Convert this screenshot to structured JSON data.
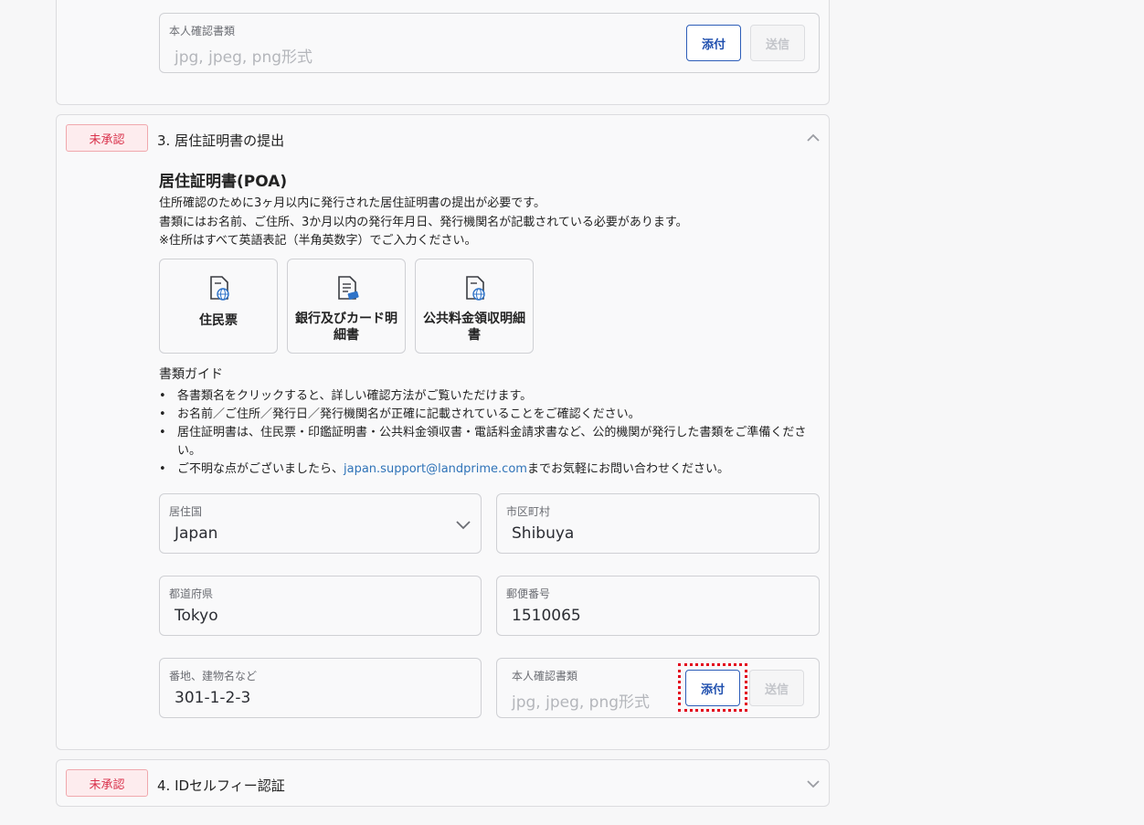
{
  "top_card": {
    "field_label": "本人確認書類",
    "field_placeholder": "jpg, jpeg, png形式",
    "attach_label": "添付",
    "send_label": "送信"
  },
  "step3": {
    "badge": "未承認",
    "title": "3. 居住証明書の提出",
    "heading": "居住証明書(POA)",
    "desc_lines": [
      "住所確認のために3ヶ月以内に発行された居住証明書の提出が必要です。",
      "書類にはお名前、ご住所、3か月以内の発行年月日、発行機関名が記載されている必要があります。",
      "※住所はすべて英語表記（半角英数字）でご入力ください。"
    ],
    "doc_types": [
      {
        "label": "住民票",
        "icon": "document-globe-icon"
      },
      {
        "label": "銀行及びカード明細書",
        "icon": "document-card-icon"
      },
      {
        "label": "公共料金領収明細書",
        "icon": "document-globe-icon"
      }
    ],
    "guide_title": "書類ガイド",
    "guide_items": [
      "各書類名をクリックすると、詳しい確認方法がご覧いただけます。",
      "お名前／ご住所／発行日／発行機関名が正確に記載されていることをご確認ください。",
      "居住証明書は、住民票・印鑑証明書・公共料金領収書・電話料金請求書など、公的機関が発行した書類をご準備ください。"
    ],
    "guide_contact_prefix": "ご不明な点がございましたら、",
    "guide_contact_email": "japan.support@landprime.com",
    "guide_contact_suffix": "までお気軽にお問い合わせください。",
    "fields": {
      "country_label": "居住国",
      "country_value": "Japan",
      "city_label": "市区町村",
      "city_value": "Shibuya",
      "prefecture_label": "都道府県",
      "prefecture_value": "Tokyo",
      "postal_label": "郵便番号",
      "postal_value": "1510065",
      "address_label": "番地、建物名など",
      "address_value": "301-1-2-3",
      "doc_label": "本人確認書類",
      "doc_placeholder": "jpg, jpeg, png形式"
    },
    "attach_label": "添付",
    "send_label": "送信"
  },
  "step4": {
    "badge": "未承認",
    "title": "4. IDセルフィー認証"
  },
  "colors": {
    "accent": "#1f4fae",
    "badge_red": "#d9304a",
    "link": "#2f73b8",
    "highlight": "#e3001b"
  }
}
